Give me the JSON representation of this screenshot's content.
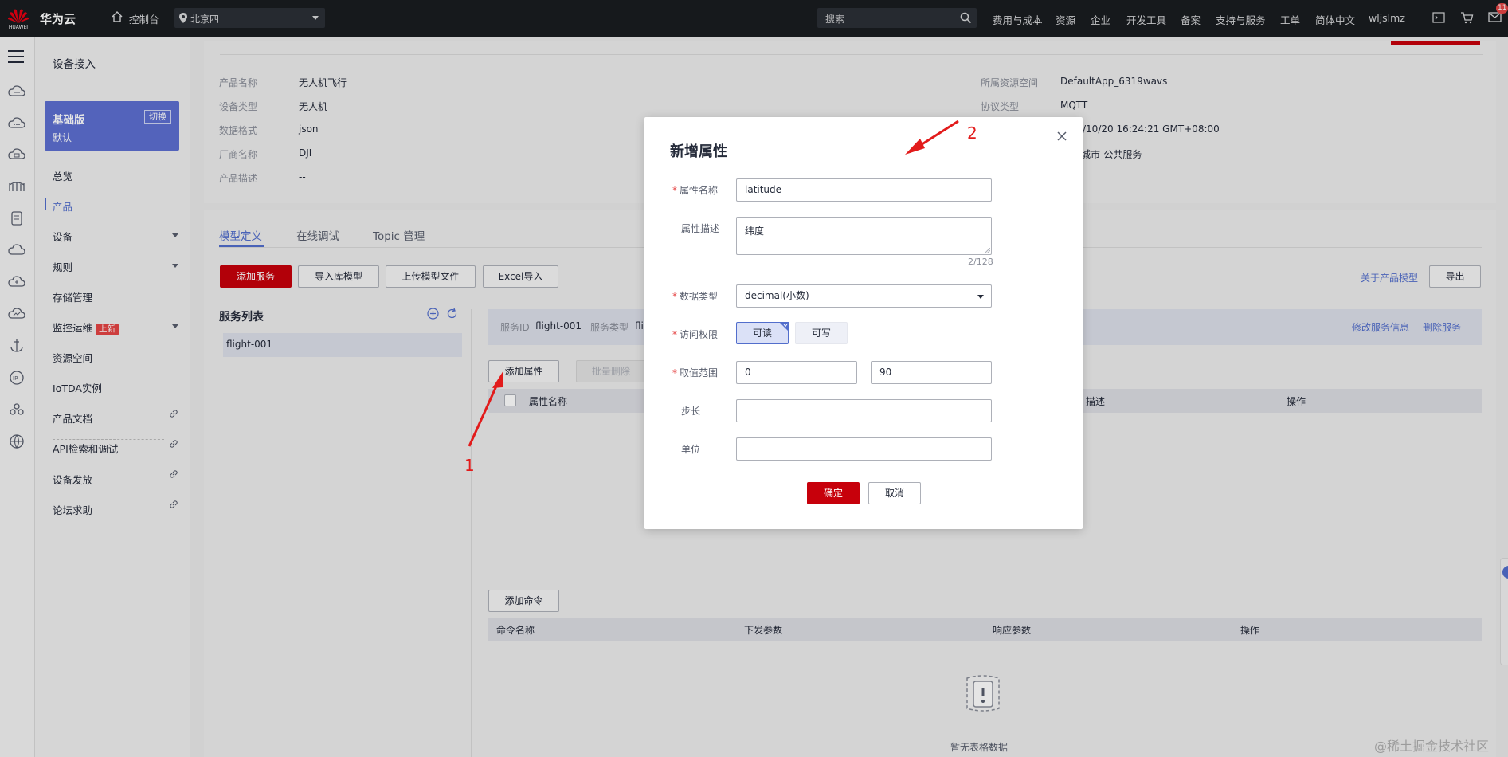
{
  "topbar": {
    "logo_text": "HUAWEI",
    "brand": "华为云",
    "console": "控制台",
    "region": "北京四",
    "search_placeholder": "搜索",
    "nav": [
      "费用与成本",
      "资源",
      "企业",
      "开发工具",
      "备案",
      "支持与服务",
      "工单",
      "简体中文",
      "wljslmz"
    ],
    "notification_count": "11"
  },
  "sidebar": {
    "title": "设备接入",
    "edition": {
      "name": "基础版",
      "switch": "切换",
      "sub": "默认"
    },
    "items": [
      {
        "label": "总览"
      },
      {
        "label": "产品"
      },
      {
        "label": "设备"
      },
      {
        "label": "规则"
      },
      {
        "label": "存储管理"
      },
      {
        "label": "监控运维",
        "badge": "上新"
      },
      {
        "label": "资源空间"
      },
      {
        "label": "IoTDA实例"
      },
      {
        "label": "产品文档"
      },
      {
        "label": "API检索和调试"
      },
      {
        "label": "设备发放"
      },
      {
        "label": "论坛求助"
      }
    ]
  },
  "product_info": {
    "left": [
      {
        "label": "产品名称",
        "value": "无人机飞行"
      },
      {
        "label": "设备类型",
        "value": "无人机"
      },
      {
        "label": "数据格式",
        "value": "json"
      },
      {
        "label": "厂商名称",
        "value": "DJI"
      },
      {
        "label": "产品描述",
        "value": "--"
      }
    ],
    "right": [
      {
        "label": "所属资源空间",
        "value": "DefaultApp_6319wavs"
      },
      {
        "label": "协议类型",
        "value": "MQTT"
      },
      {
        "label": "",
        "value": "/10/20 16:24:21 GMT+08:00"
      },
      {
        "label": "",
        "value": "城市-公共服务"
      }
    ]
  },
  "tabs": [
    "模型定义",
    "在线调试",
    "Topic 管理"
  ],
  "toolbar": {
    "add_service": "添加服务",
    "import_lib": "导入库模型",
    "upload_model": "上传模型文件",
    "excel_import": "Excel导入",
    "about_model": "关于产品模型",
    "export": "导出"
  },
  "service_list": {
    "title": "服务列表",
    "items": [
      "flight-001"
    ]
  },
  "service_detail": {
    "id_label": "服务ID",
    "id_value": "flight-001",
    "type_label": "服务类型",
    "type_value": "fli",
    "edit_link": "修改服务信息",
    "delete_link": "删除服务"
  },
  "property_table": {
    "add_button": "添加属性",
    "batch_delete": "批量删除",
    "headers": [
      "属性名称",
      "描述",
      "操作"
    ]
  },
  "command_table": {
    "add_button": "添加命令",
    "headers": [
      "命令名称",
      "下发参数",
      "响应参数",
      "操作"
    ],
    "empty": "暂无表格数据"
  },
  "modal": {
    "title": "新增属性",
    "fields": {
      "name": {
        "label": "属性名称",
        "value": "latitude"
      },
      "desc": {
        "label": "属性描述",
        "value": "纬度",
        "count": "2/128"
      },
      "type": {
        "label": "数据类型",
        "value": "decimal(小数)"
      },
      "access": {
        "label": "访问权限",
        "readable": "可读",
        "writable": "可写",
        "selected": "可读"
      },
      "range": {
        "label": "取值范围",
        "min": "0",
        "max": "90",
        "sep": "–"
      },
      "step": {
        "label": "步长",
        "value": ""
      },
      "unit": {
        "label": "单位",
        "value": ""
      }
    },
    "confirm": "确定",
    "cancel": "取消"
  },
  "annotations": {
    "one": "1",
    "two": "2"
  },
  "watermark": "@稀土掘金技术社区"
}
